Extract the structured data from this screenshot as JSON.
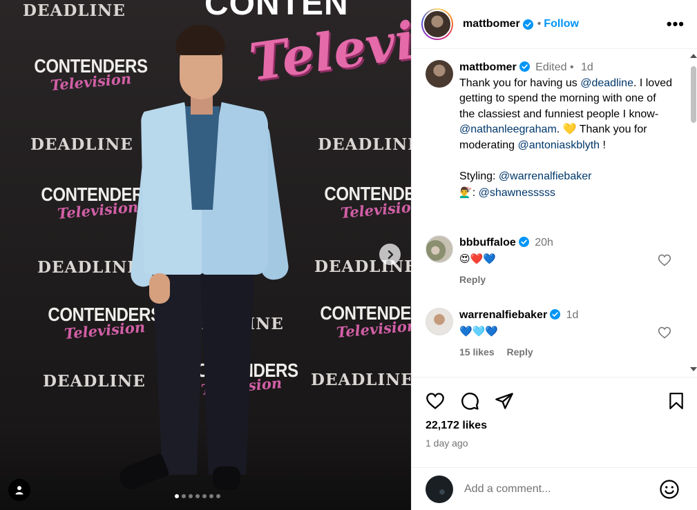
{
  "media": {
    "watermarks": {
      "deadline": "DEADLINE",
      "contenders": "CONTENDERS",
      "television": "Television",
      "top_word": "CONTEN"
    },
    "carousel_dots": 7,
    "active_dot": 0
  },
  "header": {
    "username": "mattbomer",
    "separator": "•",
    "follow_label": "Follow",
    "more_label": "•••"
  },
  "caption": {
    "username": "mattbomer",
    "edited": "Edited",
    "separator": "•",
    "time": "1d",
    "parts": {
      "p1": "Thank you for having us ",
      "m1": "@deadline",
      "p2": ". I loved getting to spend the morning with one of the classiest and funniest people I know- ",
      "m2": "@nathanleegraham",
      "p3": ". 💛 Thank you for moderating ",
      "m3": "@antoniaskblyth",
      "p4": " !",
      "styling_label": "Styling: ",
      "m4": "@warrenalfiebaker",
      "hair_emoji": "💇‍♂️",
      "hair_sep": ": ",
      "m5": "@shawnesssss"
    }
  },
  "comments": [
    {
      "username": "bbbuffaloe",
      "time": "20h",
      "text": "😍❤️💙",
      "likes": "",
      "reply_label": "Reply"
    },
    {
      "username": "warrenalfiebaker",
      "time": "1d",
      "text": "💙🩵💙",
      "likes": "15 likes",
      "reply_label": "Reply"
    }
  ],
  "stats": {
    "likes": "22,172 likes",
    "posted": "1 day ago"
  },
  "add_comment": {
    "placeholder": "Add a comment..."
  },
  "colors": {
    "link": "#00376b",
    "accent": "#0095f6",
    "muted": "#737373"
  }
}
